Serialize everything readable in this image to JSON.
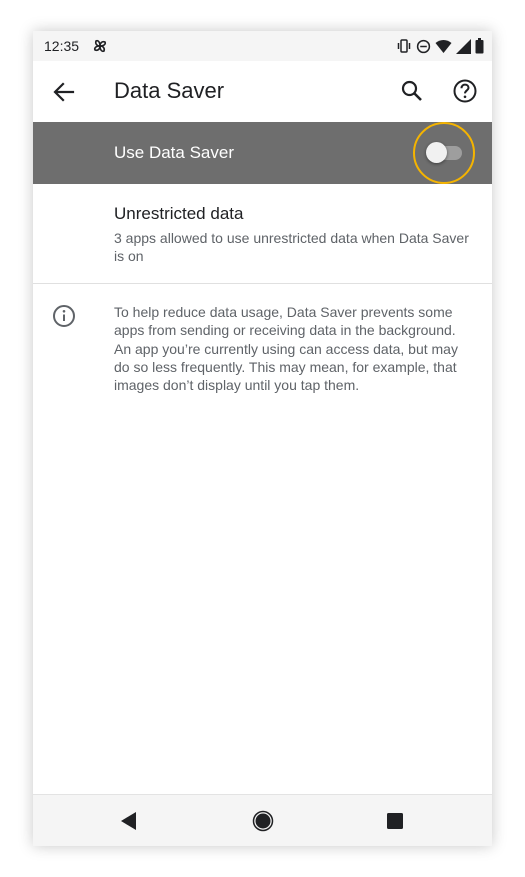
{
  "status_bar": {
    "time": "12:35",
    "left_icon": "pinwheel-notification-icon",
    "right_icons": [
      "vibrate-icon",
      "do-not-disturb-icon",
      "wifi-icon",
      "cellular-signal-icon",
      "battery-icon"
    ]
  },
  "app_bar": {
    "title": "Data Saver",
    "back_icon": "arrow-back-icon",
    "search_icon": "search-icon",
    "help_icon": "help-icon"
  },
  "main_switch": {
    "label": "Use Data Saver",
    "checked": false,
    "highlight_color": "#f5b400"
  },
  "unrestricted": {
    "title": "Unrestricted data",
    "summary": "3 apps allowed to use unrestricted data when Data Saver is on"
  },
  "info": {
    "icon": "info-icon",
    "text": "To help reduce data usage, Data Saver prevents some apps from sending or receiving data in the background. An app you’re currently using can access data, but may do so less frequently. This may mean, for example, that images don’t display until you tap them."
  },
  "nav_bar": {
    "back_icon": "nav-back-icon",
    "home_icon": "nav-home-icon",
    "recents_icon": "nav-recents-icon"
  },
  "colors": {
    "switch_bar_background": "#6e6e6e",
    "toggle_highlight": "#f5b400",
    "secondary_text": "#5f6368"
  }
}
